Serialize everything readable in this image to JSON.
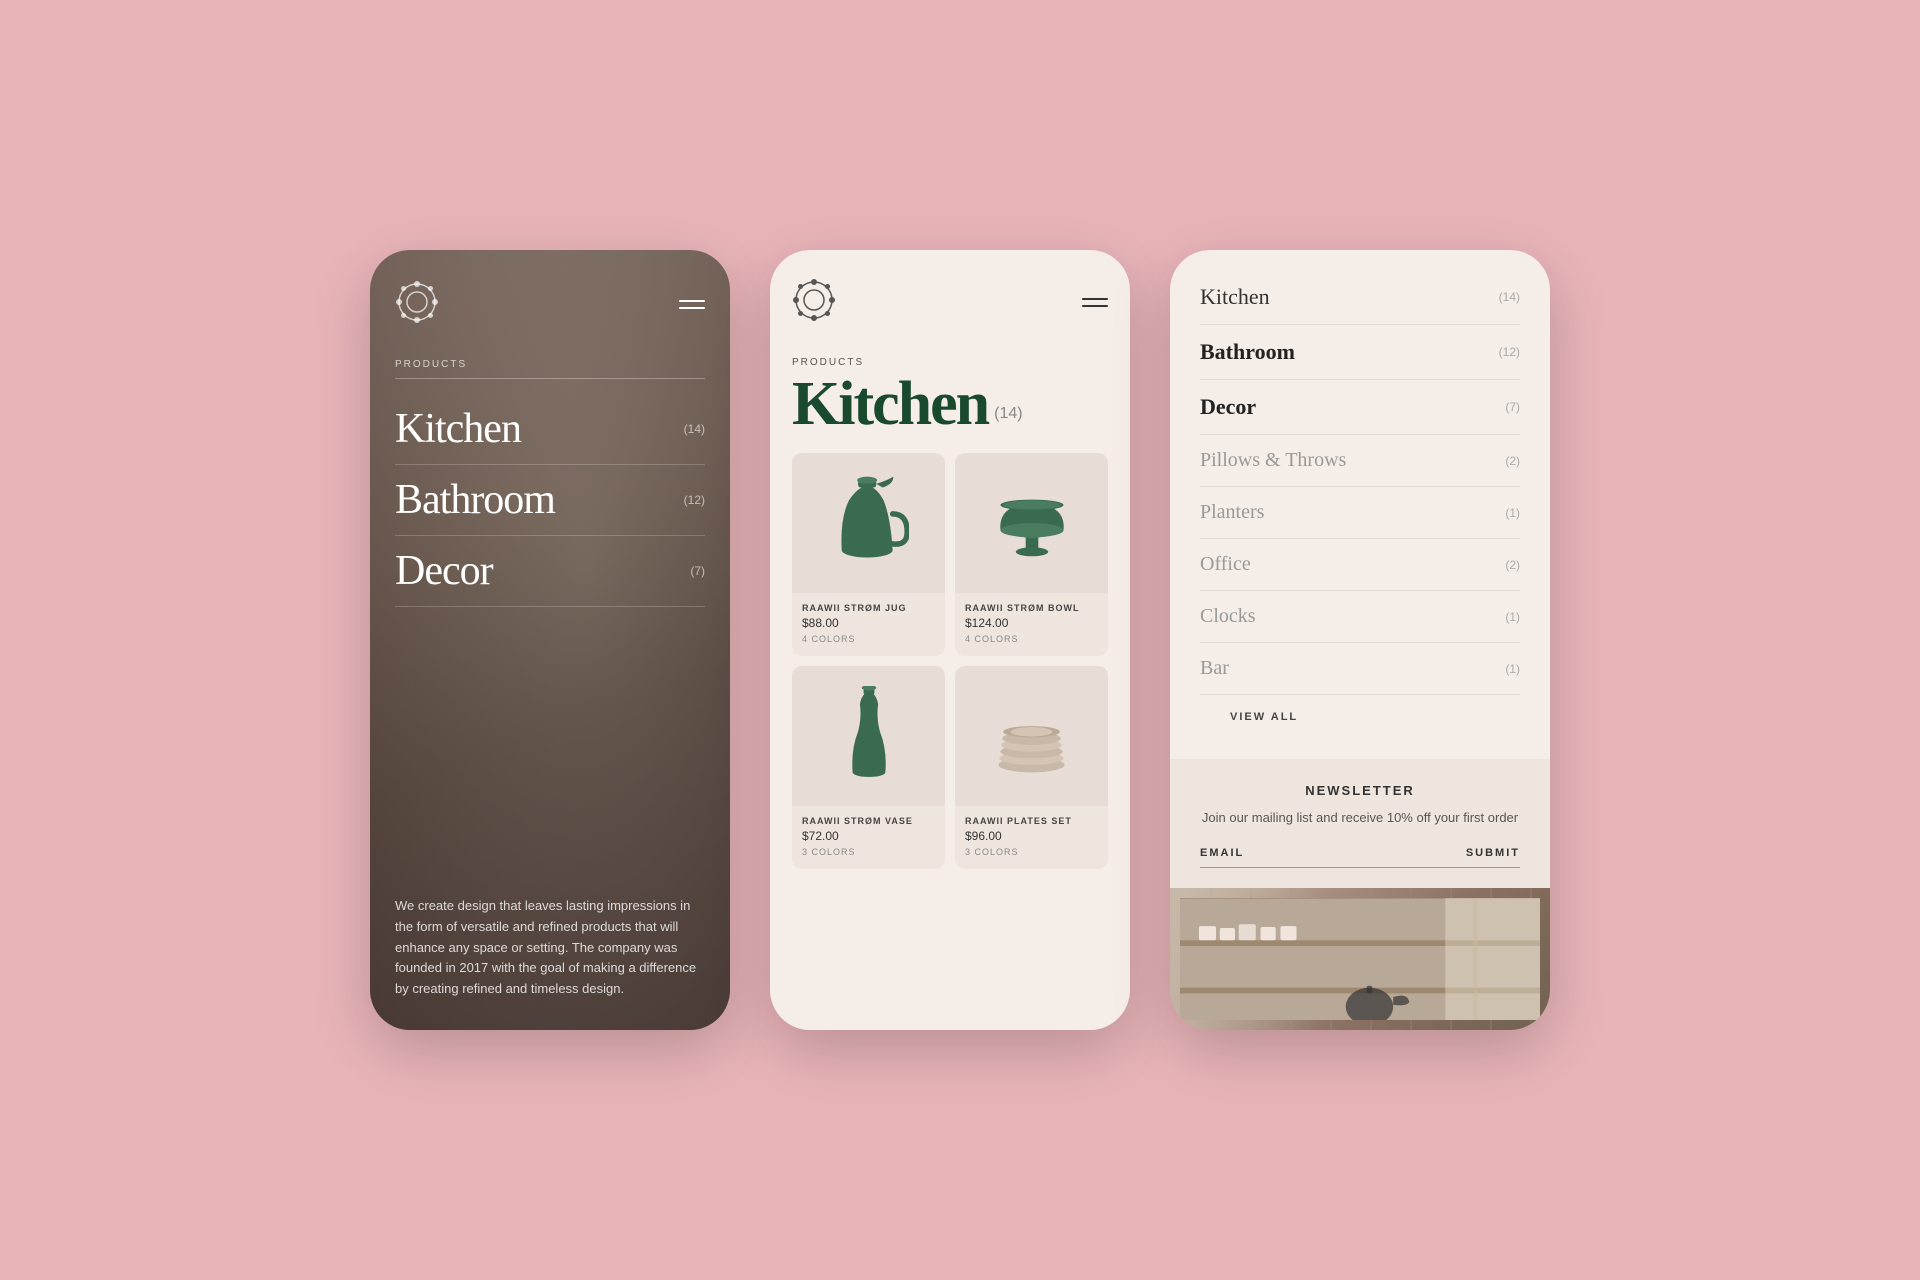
{
  "phone1": {
    "products_label": "PRODUCTS",
    "nav_items": [
      {
        "label": "Kitchen",
        "count": "(14)"
      },
      {
        "label": "Bathroom",
        "count": "(12)"
      },
      {
        "label": "Decor",
        "count": "(7)"
      }
    ],
    "description": "We create design that leaves lasting impressions in the form of versatile and refined products that will enhance any space or setting. The company was founded in 2017 with the goal of making a difference by creating refined and timeless design."
  },
  "phone2": {
    "products_label": "PRODUCTS",
    "heading": "Kitchen",
    "count": "(14)",
    "products": [
      {
        "name": "RAAWII STRØM JUG",
        "price": "$88.00",
        "colors": "4 COLORS"
      },
      {
        "name": "RAAWII STRØM BOWL",
        "price": "$124.00",
        "colors": "4 COLORS"
      },
      {
        "name": "RAAWII STRØM VASE",
        "price": "$72.00",
        "colors": "3 COLORS"
      },
      {
        "name": "RAAWII PLATES SET",
        "price": "$96.00",
        "colors": "3 COLORS"
      }
    ]
  },
  "phone3": {
    "menu_items": [
      {
        "label": "Kitchen",
        "count": "(14)",
        "active": false,
        "light": false
      },
      {
        "label": "Bathroom",
        "count": "(12)",
        "active": true,
        "light": false
      },
      {
        "label": "Decor",
        "count": "(7)",
        "active": true,
        "light": false
      },
      {
        "label": "Pillows & Throws",
        "count": "(2)",
        "active": false,
        "light": true
      },
      {
        "label": "Planters",
        "count": "(1)",
        "active": false,
        "light": true
      },
      {
        "label": "Office",
        "count": "(2)",
        "active": false,
        "light": true
      },
      {
        "label": "Clocks",
        "count": "(1)",
        "active": false,
        "light": true
      },
      {
        "label": "Bar",
        "count": "(1)",
        "active": false,
        "light": true
      }
    ],
    "view_all": "VIEW ALL",
    "newsletter": {
      "title": "NEWSLETTER",
      "description": "Join our mailing list and receive 10% off your first order",
      "email_label": "EMAIL",
      "submit_label": "SUBMIT"
    }
  }
}
